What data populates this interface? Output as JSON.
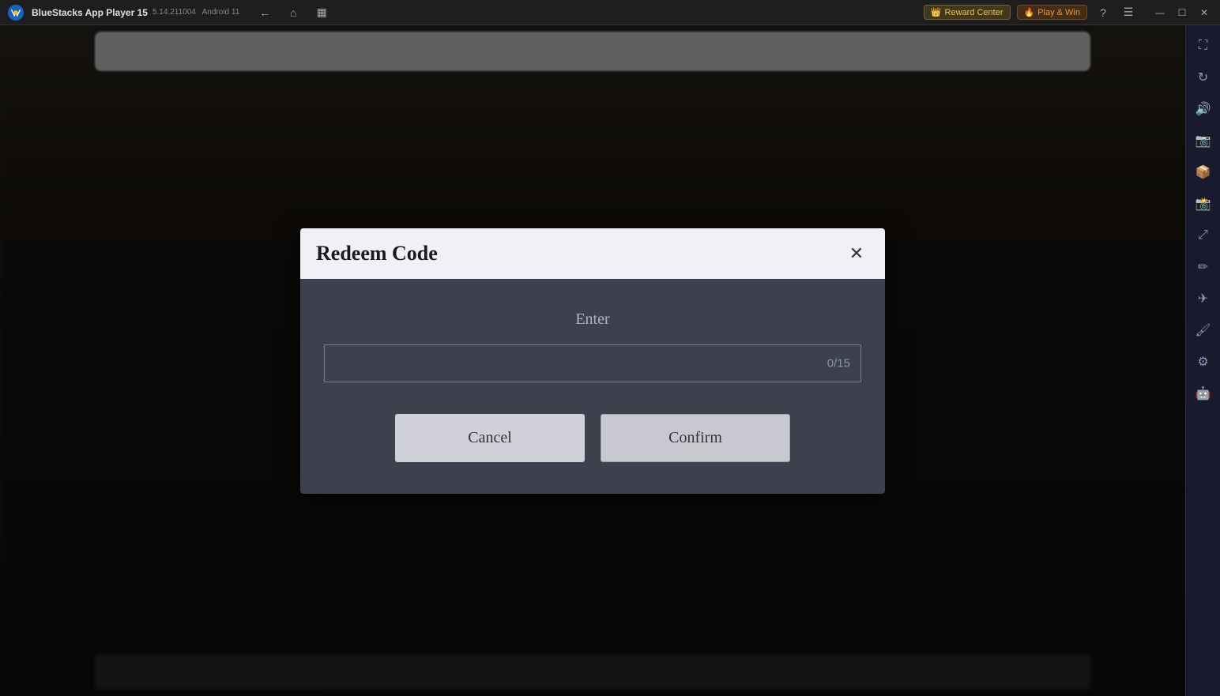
{
  "app": {
    "name": "BlueStacks App Player 15",
    "version": "5.14.211004",
    "os": "Android 11"
  },
  "titlebar": {
    "reward_center_label": "Reward Center",
    "play_win_label": "Play & Win",
    "nav": {
      "back_title": "Back",
      "home_title": "Home",
      "multi_title": "Multi-instance"
    },
    "window_buttons": {
      "minimize": "—",
      "maximize": "☐",
      "close": "✕",
      "restore": "❐"
    }
  },
  "dialog": {
    "title": "Redeem Code",
    "enter_label": "Enter",
    "input_placeholder": "",
    "char_count": "0/15",
    "cancel_label": "Cancel",
    "confirm_label": "Confirm",
    "close_icon": "✕"
  },
  "sidebar": {
    "icons": [
      {
        "name": "expand-icon",
        "symbol": "⛶"
      },
      {
        "name": "rotate-icon",
        "symbol": "↻"
      },
      {
        "name": "volume-icon",
        "symbol": "🔊"
      },
      {
        "name": "camera-icon",
        "symbol": "📷"
      },
      {
        "name": "apk-icon",
        "symbol": "📦"
      },
      {
        "name": "screenshot-icon",
        "symbol": "📸"
      },
      {
        "name": "resize-icon",
        "symbol": "⤢"
      },
      {
        "name": "edit-icon",
        "symbol": "✏"
      },
      {
        "name": "flight-icon",
        "symbol": "✈"
      },
      {
        "name": "brush-icon",
        "symbol": "🖌"
      },
      {
        "name": "settings-icon",
        "symbol": "⚙"
      },
      {
        "name": "android-icon",
        "symbol": "🤖"
      }
    ]
  }
}
